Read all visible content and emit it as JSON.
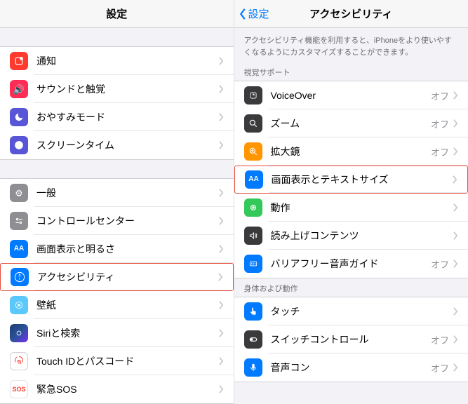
{
  "left": {
    "title": "設定",
    "group1": [
      {
        "label": "通知",
        "name": "notifications"
      },
      {
        "label": "サウンドと触覚",
        "name": "sounds"
      },
      {
        "label": "おやすみモード",
        "name": "dnd"
      },
      {
        "label": "スクリーンタイム",
        "name": "screentime"
      }
    ],
    "group2": [
      {
        "label": "一般",
        "name": "general"
      },
      {
        "label": "コントロールセンター",
        "name": "control-center"
      },
      {
        "label": "画面表示と明るさ",
        "name": "display"
      },
      {
        "label": "アクセシビリティ",
        "name": "accessibility",
        "highlighted": true
      },
      {
        "label": "壁紙",
        "name": "wallpaper"
      },
      {
        "label": "Siriと検索",
        "name": "siri"
      },
      {
        "label": "Touch IDとパスコード",
        "name": "touchid"
      },
      {
        "label": "緊急SOS",
        "name": "sos"
      }
    ]
  },
  "right": {
    "back": "設定",
    "title": "アクセシビリティ",
    "info": "アクセシビリティ機能を利用すると、iPhoneをより使いやすくなるようにカスタマイズすることができます。",
    "section1_title": "視覚サポート",
    "section1": [
      {
        "label": "VoiceOver",
        "status": "オフ",
        "name": "voiceover"
      },
      {
        "label": "ズーム",
        "status": "オフ",
        "name": "zoom"
      },
      {
        "label": "拡大鏡",
        "status": "オフ",
        "name": "magnifier"
      },
      {
        "label": "画面表示とテキストサイズ",
        "name": "display-text",
        "highlighted": true
      },
      {
        "label": "動作",
        "name": "motion"
      },
      {
        "label": "読み上げコンテンツ",
        "name": "spoken"
      },
      {
        "label": "バリアフリー音声ガイド",
        "status": "オフ",
        "name": "audio-desc"
      }
    ],
    "section2_title": "身体および動作",
    "section2": [
      {
        "label": "タッチ",
        "name": "touch"
      },
      {
        "label": "スイッチコントロール",
        "status": "オフ",
        "name": "switch"
      },
      {
        "label": "音声コン",
        "status": "オフ",
        "name": "voice-control"
      }
    ]
  }
}
